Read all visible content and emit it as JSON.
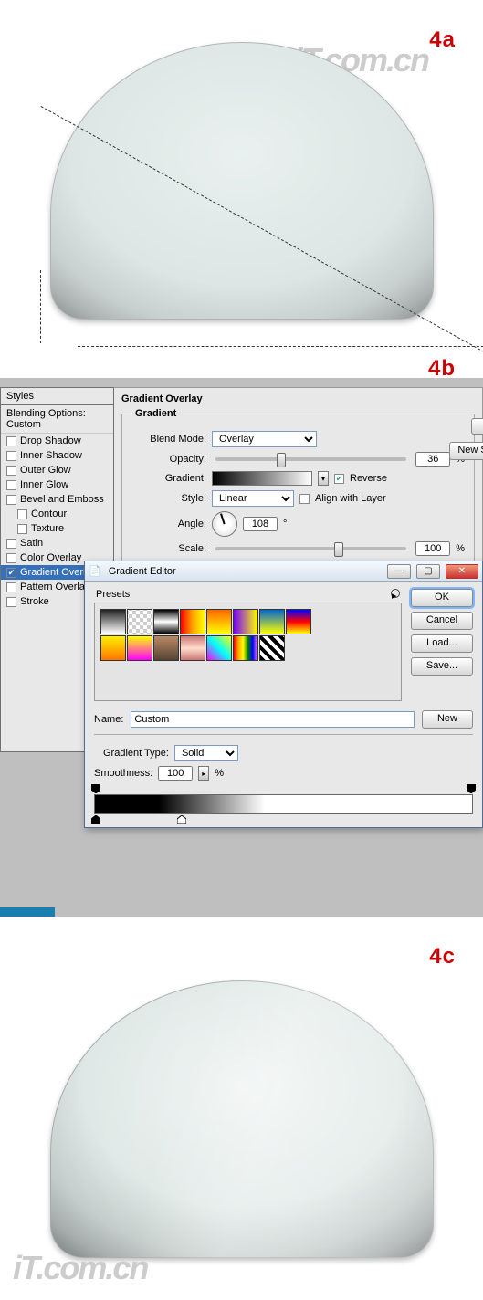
{
  "figures": {
    "a": "4a",
    "b": "4b",
    "c": "4c"
  },
  "watermark": "iT.com.cn",
  "styles": {
    "header": "Styles",
    "subheader": "Blending Options: Custom",
    "items": [
      {
        "label": "Drop Shadow"
      },
      {
        "label": "Inner Shadow"
      },
      {
        "label": "Outer Glow"
      },
      {
        "label": "Inner Glow"
      },
      {
        "label": "Bevel and Emboss"
      },
      {
        "label": "Contour",
        "indent": true
      },
      {
        "label": "Texture",
        "indent": true
      },
      {
        "label": "Satin"
      },
      {
        "label": "Color Overlay"
      },
      {
        "label": "Gradient Overlay",
        "selected": true,
        "checked": true
      },
      {
        "label": "Pattern Overlay"
      },
      {
        "label": "Stroke"
      }
    ]
  },
  "overlay": {
    "title": "Gradient Overlay",
    "legend": "Gradient",
    "blendModeLabel": "Blend Mode:",
    "blendMode": "Overlay",
    "opacityLabel": "Opacity:",
    "opacity": "36",
    "opacityUnit": "%",
    "gradientLabel": "Gradient:",
    "reverse": "Reverse",
    "styleLabel": "Style:",
    "style": "Linear",
    "align": "Align with Layer",
    "angleLabel": "Angle:",
    "angle": "108",
    "angleUnit": "°",
    "scaleLabel": "Scale:",
    "scale": "100",
    "scaleUnit": "%",
    "newStyleBtn": "New Style..."
  },
  "editor": {
    "title": "Gradient Editor",
    "presets": "Presets",
    "ok": "OK",
    "cancel": "Cancel",
    "load": "Load...",
    "save": "Save...",
    "nameLabel": "Name:",
    "name": "Custom",
    "new": "New",
    "typeLabel": "Gradient Type:",
    "type": "Solid",
    "smoothLabel": "Smoothness:",
    "smooth": "100",
    "smoothUnit": "%"
  }
}
